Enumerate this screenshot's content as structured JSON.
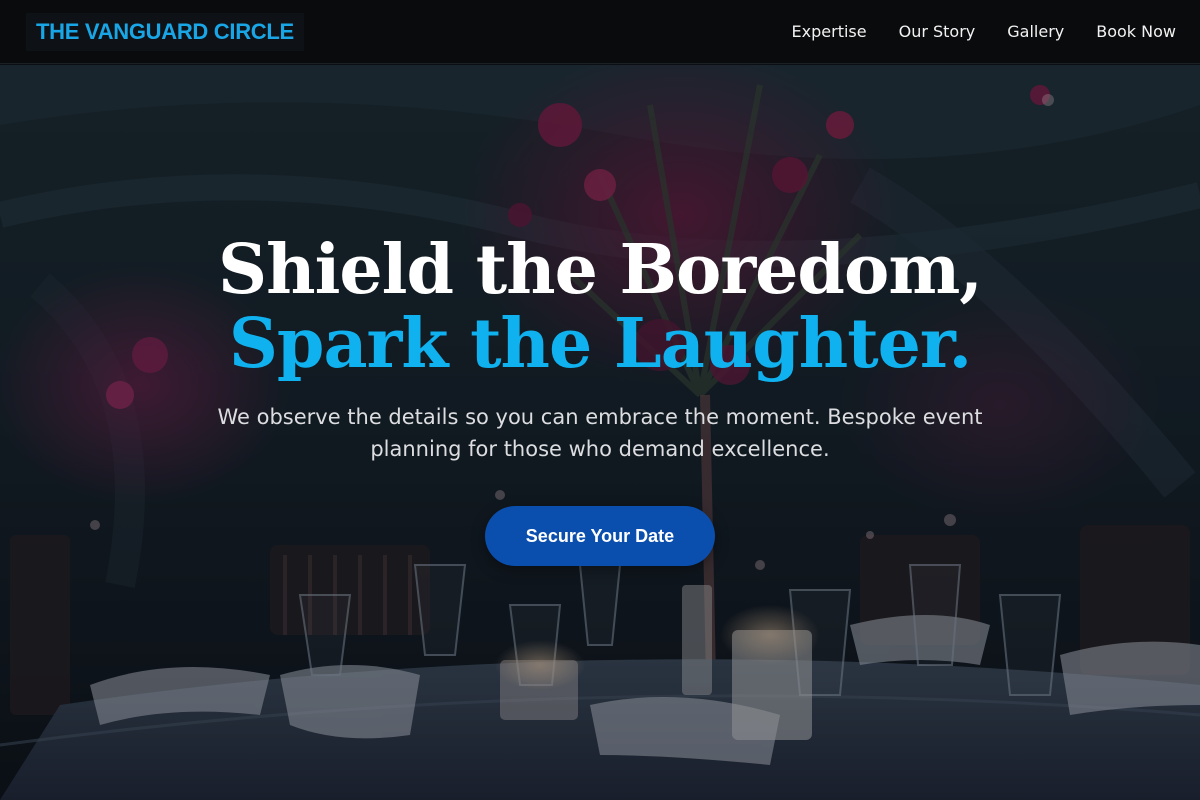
{
  "brand": {
    "name": "THE VANGUARD CIRCLE",
    "color": "#19a6e6"
  },
  "nav": {
    "items": [
      {
        "label": "Expertise"
      },
      {
        "label": "Our Story"
      },
      {
        "label": "Gallery"
      },
      {
        "label": "Book Now"
      }
    ]
  },
  "hero": {
    "headline_line1": "Shield the Boredom,",
    "headline_line2": "Spark the Laughter.",
    "subtitle": "We observe the details so you can embrace the moment. Bespoke event planning for those who demand excellence.",
    "cta_label": "Secure Your Date",
    "colors": {
      "accent": "#0fb1ef",
      "button": "#0b4fae"
    }
  }
}
